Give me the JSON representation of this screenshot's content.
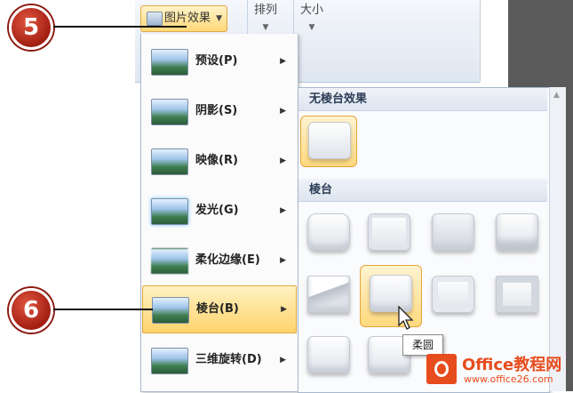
{
  "ribbon": {
    "picture_effects_label": "图片效果",
    "arrange_label": "排列",
    "size_label": "大小"
  },
  "callouts": [
    "5",
    "6"
  ],
  "menu": {
    "items": [
      {
        "label": "预设(P)",
        "icon": "preset-thumbnail-icon"
      },
      {
        "label": "阴影(S)",
        "icon": "shadow-thumbnail-icon"
      },
      {
        "label": "映像(R)",
        "icon": "reflection-thumbnail-icon"
      },
      {
        "label": "发光(G)",
        "icon": "glow-thumbnail-icon"
      },
      {
        "label": "柔化边缘(E)",
        "icon": "soft-edges-thumbnail-icon"
      },
      {
        "label": "棱台(B)",
        "icon": "bevel-thumbnail-icon",
        "active": true
      },
      {
        "label": "三维旋转(D)",
        "icon": "3d-rotation-thumbnail-icon"
      }
    ]
  },
  "gallery": {
    "no_bevel_header": "无棱台效果",
    "bevel_header": "棱台",
    "tooltip": "柔圆",
    "selected_tile": "柔圆"
  },
  "watermark": {
    "title": "Office教程网",
    "url": "www.office26.com"
  },
  "colors": {
    "highlight": "#ffd36d",
    "callout": "#b5261a",
    "watermark": "#e74c1c"
  }
}
